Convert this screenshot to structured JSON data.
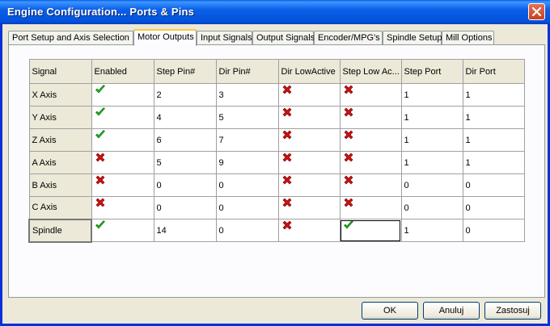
{
  "window": {
    "title": "Engine Configuration... Ports & Pins"
  },
  "tabs": [
    {
      "label": "Port Setup and Axis Selection"
    },
    {
      "label": "Motor Outputs"
    },
    {
      "label": "Input Signals"
    },
    {
      "label": "Output Signals"
    },
    {
      "label": "Encoder/MPG's"
    },
    {
      "label": "Spindle Setup"
    },
    {
      "label": "Mill Options"
    }
  ],
  "active_tab": "Motor Outputs",
  "table": {
    "columns": [
      "Signal",
      "Enabled",
      "Step Pin#",
      "Dir Pin#",
      "Dir LowActive",
      "Step Low Ac...",
      "Step Port",
      "Dir Port"
    ],
    "rows": [
      {
        "signal": "X Axis",
        "enabled": "check",
        "step_pin": "2",
        "dir_pin": "3",
        "dir_low": "cross",
        "step_low": "cross",
        "step_port": "1",
        "dir_port": "1"
      },
      {
        "signal": "Y Axis",
        "enabled": "check",
        "step_pin": "4",
        "dir_pin": "5",
        "dir_low": "cross",
        "step_low": "cross",
        "step_port": "1",
        "dir_port": "1"
      },
      {
        "signal": "Z Axis",
        "enabled": "check",
        "step_pin": "6",
        "dir_pin": "7",
        "dir_low": "cross",
        "step_low": "cross",
        "step_port": "1",
        "dir_port": "1"
      },
      {
        "signal": "A Axis",
        "enabled": "cross",
        "step_pin": "5",
        "dir_pin": "9",
        "dir_low": "cross",
        "step_low": "cross",
        "step_port": "1",
        "dir_port": "1"
      },
      {
        "signal": "B Axis",
        "enabled": "cross",
        "step_pin": "0",
        "dir_pin": "0",
        "dir_low": "cross",
        "step_low": "cross",
        "step_port": "0",
        "dir_port": "0"
      },
      {
        "signal": "C Axis",
        "enabled": "cross",
        "step_pin": "0",
        "dir_pin": "0",
        "dir_low": "cross",
        "step_low": "cross",
        "step_port": "0",
        "dir_port": "0"
      },
      {
        "signal": "Spindle",
        "enabled": "check",
        "step_pin": "14",
        "dir_pin": "0",
        "dir_low": "cross",
        "step_low": "check",
        "step_port": "1",
        "dir_port": "0"
      }
    ]
  },
  "buttons": {
    "ok": "OK",
    "cancel": "Anuluj",
    "apply": "Zastosuj"
  },
  "colors": {
    "check": "#22b022",
    "cross": "#cc1111",
    "title_bar": "#0a5fe8",
    "active_tab_accent": "#ffc83c"
  },
  "icons": {
    "check": "check-icon",
    "cross": "cross-icon",
    "close": "close-icon"
  }
}
